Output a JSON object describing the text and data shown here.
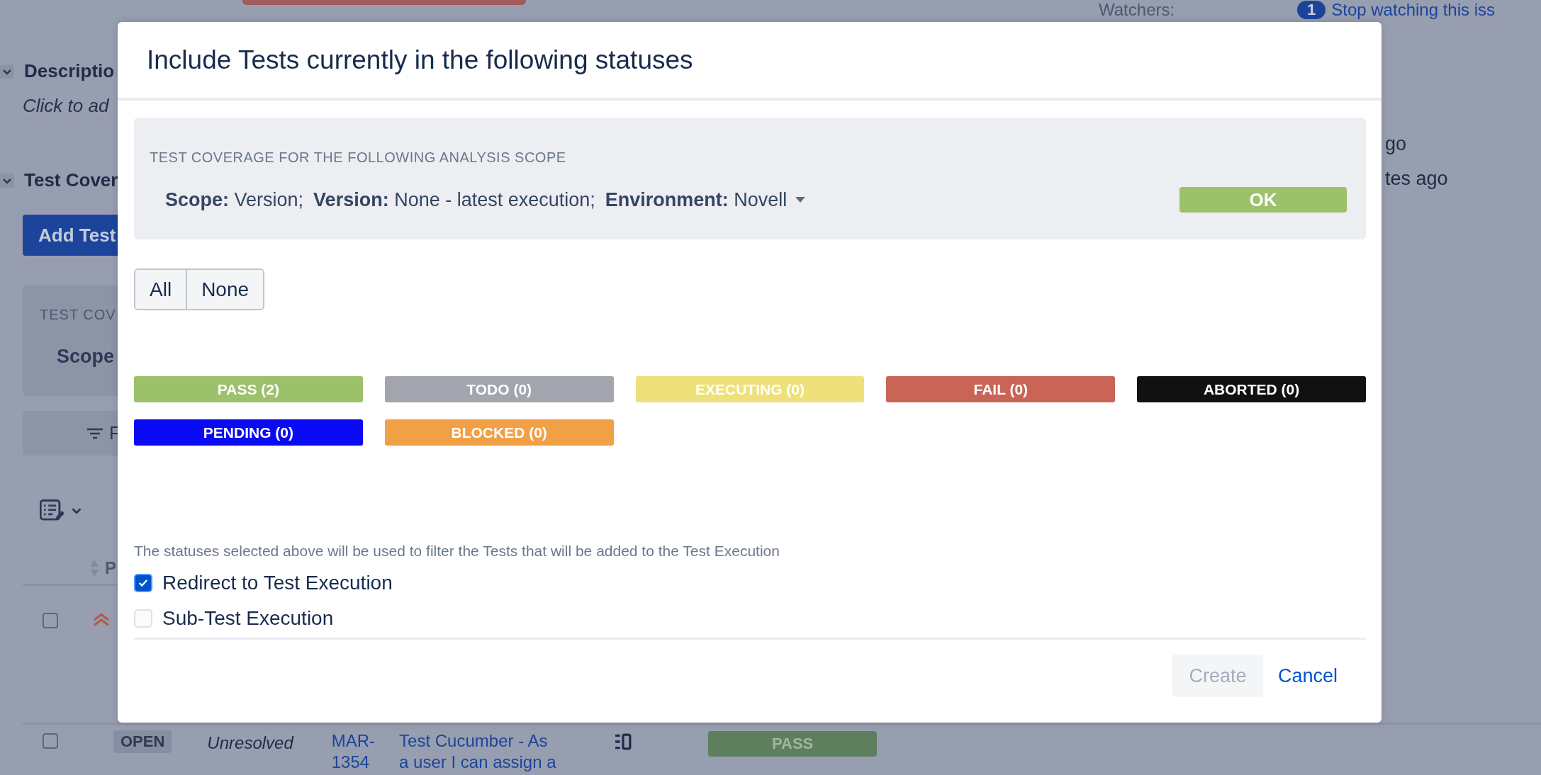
{
  "background": {
    "watchers_label": "Watchers:",
    "watchers_count": "1",
    "watch_link": "Stop watching this iss",
    "sections": [
      {
        "title": "Descriptio"
      },
      {
        "title": "Test Cover"
      }
    ],
    "description_placeholder": "Click to ad",
    "add_button": "Add Test",
    "coverage_label": "TEST COV",
    "coverage_scope": "Scope",
    "filter_label": "F",
    "column_header": "P",
    "activity": [
      "go",
      "tes ago"
    ],
    "rows": [
      {
        "checked": false,
        "kind": "priority"
      },
      {
        "checked": false,
        "kind": "issue",
        "status": "OPEN",
        "resolution": "Unresolved",
        "key": "MAR-\n1354",
        "summary": "Test Cucumber - As\na user I can assign a",
        "test_status": "PASS"
      }
    ]
  },
  "dialog": {
    "title": "Include Tests currently in the following statuses",
    "scope_panel": {
      "heading": "TEST COVERAGE FOR THE FOLLOWING ANALYSIS SCOPE",
      "items": [
        {
          "label": "Scope:",
          "value": "Version;"
        },
        {
          "label": "Version:",
          "value": "None - latest execution;"
        },
        {
          "label": "Environment:",
          "value": "Novell",
          "kind": "dropdown"
        }
      ],
      "ok_button": "OK"
    },
    "select_buttons": [
      "All",
      "None"
    ],
    "statuses": [
      {
        "label": "PASS (2)",
        "color": "#9dc06b",
        "selected": true
      },
      {
        "label": "TODO (0)",
        "color": "#a2a5ad",
        "selected": true
      },
      {
        "label": "EXECUTING (0)",
        "color": "#eee17a",
        "selected": true
      },
      {
        "label": "FAIL (0)",
        "color": "#c96456",
        "selected": true
      },
      {
        "label": "ABORTED (0)",
        "color": "#111111",
        "selected": true
      },
      {
        "label": "PENDING (0)",
        "color": "#0a0af5",
        "selected": true
      },
      {
        "label": "BLOCKED (0)",
        "color": "#f2a045",
        "selected": true
      }
    ],
    "help_text": "The statuses selected above will be used to filter the Tests that will be added to the Test Execution",
    "options": [
      {
        "label": "Redirect to Test Execution",
        "checked": true
      },
      {
        "label": "Sub-Test Execution",
        "checked": false
      }
    ],
    "create_button": {
      "label": "Create",
      "disabled": true
    },
    "cancel_link": "Cancel"
  }
}
